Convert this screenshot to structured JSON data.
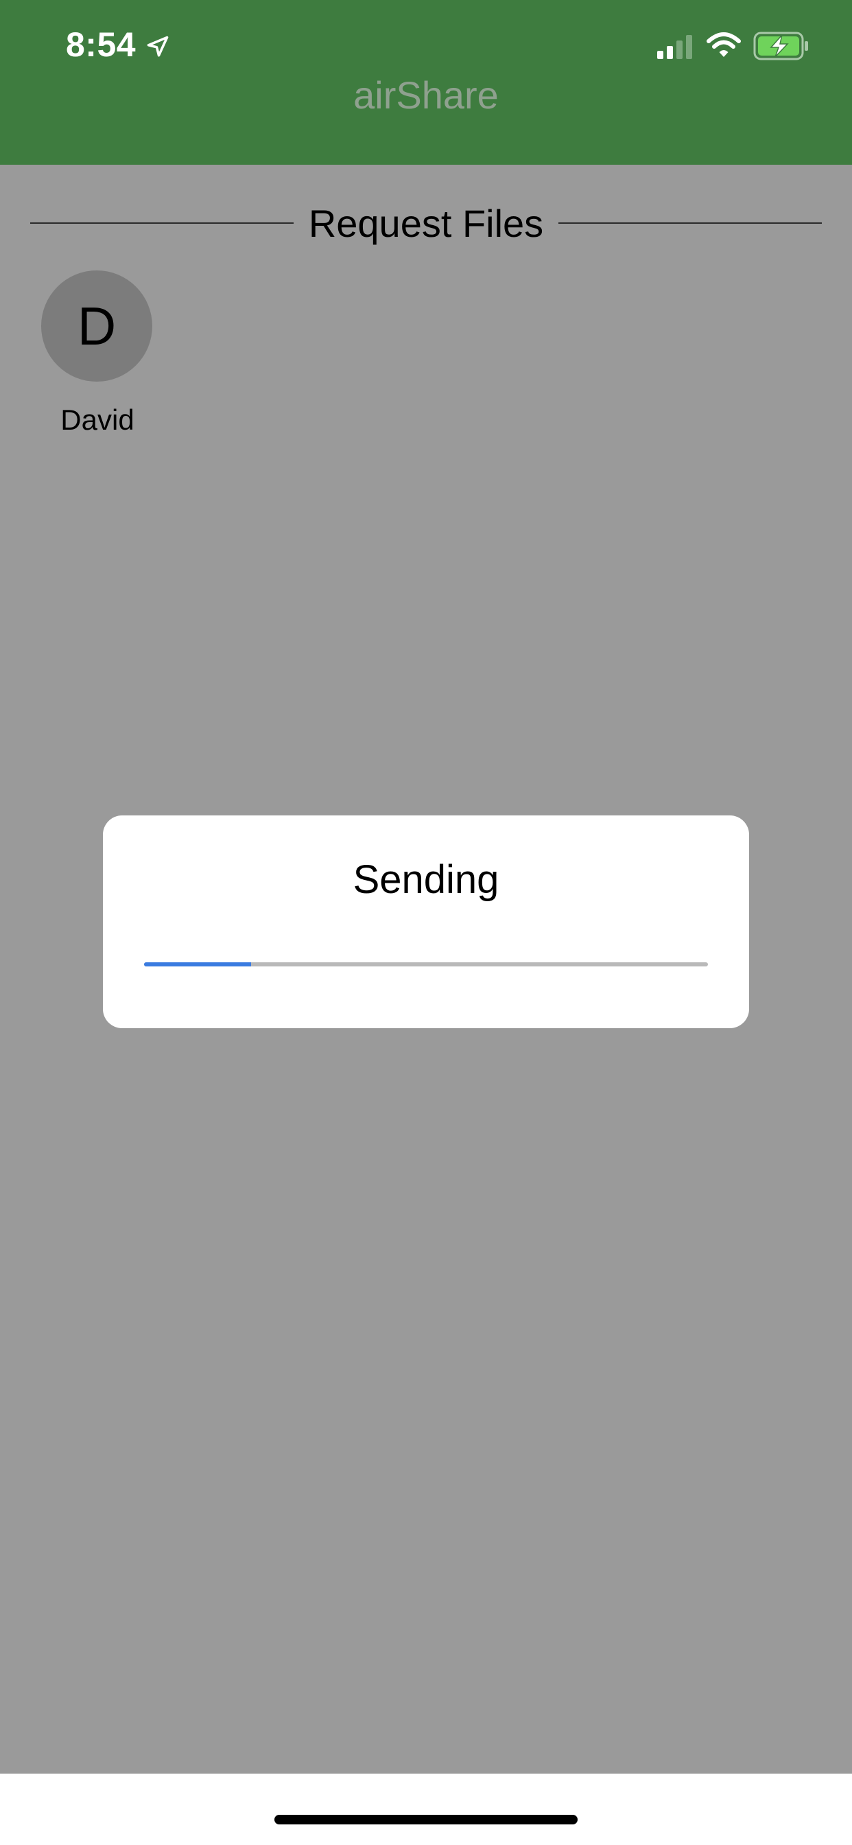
{
  "status_bar": {
    "time": "8:54",
    "icons": [
      "location-arrow-icon",
      "cellular-signal-icon",
      "wifi-icon",
      "battery-charging-icon"
    ]
  },
  "header": {
    "title": "airShare"
  },
  "section": {
    "title": "Request Files"
  },
  "devices": [
    {
      "initial": "D",
      "name": "David"
    }
  ],
  "modal": {
    "title": "Sending",
    "progress": 0.19,
    "progress_color": "#3a7be0"
  },
  "colors": {
    "header": "#3e7c3f",
    "overlay": "#9a9a9a",
    "battery_fill": "#6fd35b"
  }
}
